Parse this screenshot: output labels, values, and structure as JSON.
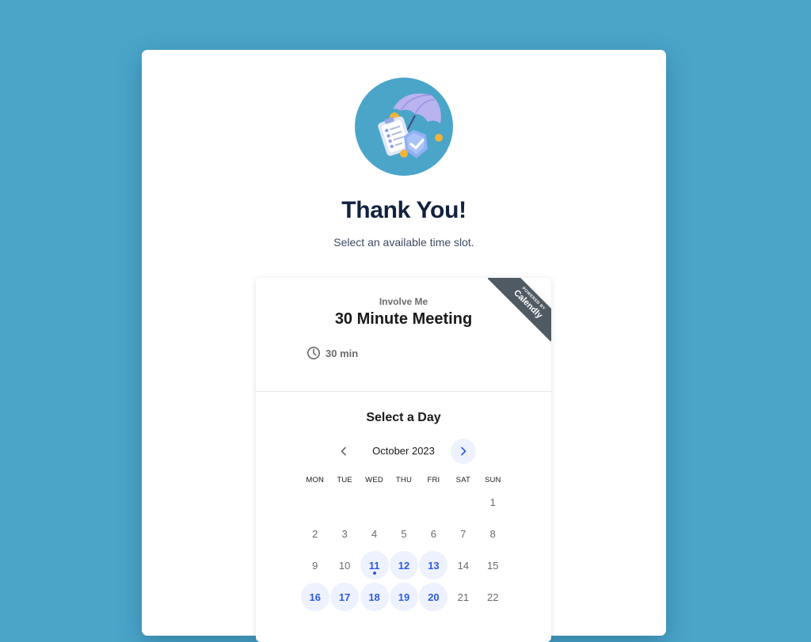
{
  "page": {
    "title": "Thank You!",
    "subtitle": "Select an available time slot.",
    "avatar_icon": "insurance-umbrella-clipboard-shield-icon",
    "background_color": "#4aa5c9"
  },
  "widget": {
    "ribbon": {
      "powered_by": "POWERED BY",
      "brand": "Calendly"
    },
    "organizer": "Involve Me",
    "event_name": "30 Minute Meeting",
    "duration": {
      "icon": "clock-icon",
      "label": "30 min"
    },
    "select_day_title": "Select a Day",
    "month_label": "October 2023",
    "prev_icon": "chevron-left-icon",
    "next_icon": "chevron-right-icon",
    "accent_color": "#2d5be3",
    "weekdays": [
      "MON",
      "TUE",
      "WED",
      "THU",
      "FRI",
      "SAT",
      "SUN"
    ],
    "days": [
      {
        "label": "",
        "available": false
      },
      {
        "label": "",
        "available": false
      },
      {
        "label": "",
        "available": false
      },
      {
        "label": "",
        "available": false
      },
      {
        "label": "",
        "available": false
      },
      {
        "label": "",
        "available": false
      },
      {
        "label": "1",
        "available": false
      },
      {
        "label": "2",
        "available": false
      },
      {
        "label": "3",
        "available": false
      },
      {
        "label": "4",
        "available": false
      },
      {
        "label": "5",
        "available": false
      },
      {
        "label": "6",
        "available": false
      },
      {
        "label": "7",
        "available": false
      },
      {
        "label": "8",
        "available": false
      },
      {
        "label": "9",
        "available": false
      },
      {
        "label": "10",
        "available": false
      },
      {
        "label": "11",
        "available": true,
        "today": true
      },
      {
        "label": "12",
        "available": true
      },
      {
        "label": "13",
        "available": true
      },
      {
        "label": "14",
        "available": false
      },
      {
        "label": "15",
        "available": false
      },
      {
        "label": "16",
        "available": true
      },
      {
        "label": "17",
        "available": true
      },
      {
        "label": "18",
        "available": true
      },
      {
        "label": "19",
        "available": true
      },
      {
        "label": "20",
        "available": true
      },
      {
        "label": "21",
        "available": false
      },
      {
        "label": "22",
        "available": false
      }
    ]
  }
}
